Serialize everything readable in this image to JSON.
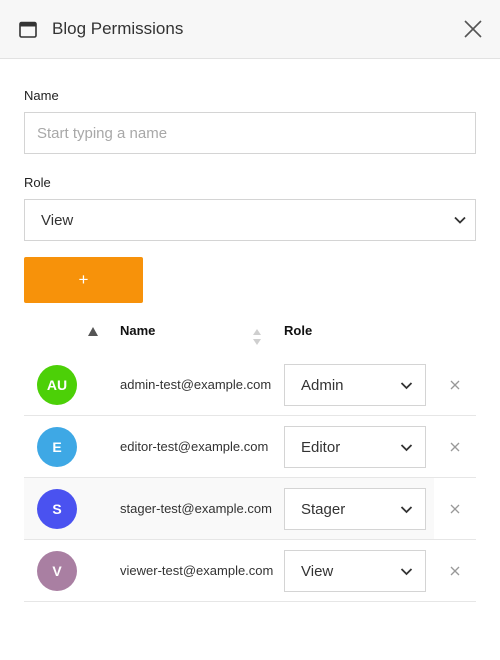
{
  "header": {
    "title": "Blog Permissions",
    "icon": "calendar-icon",
    "close_icon": "close-icon"
  },
  "form": {
    "name_label": "Name",
    "name_placeholder": "Start typing a name",
    "name_value": "",
    "role_label": "Role",
    "role_value": "View",
    "add_button_label": "+",
    "add_button_color": "#f7920a"
  },
  "table": {
    "columns": [
      "Name",
      "Role"
    ],
    "sort_column": "Name",
    "rows": [
      {
        "initials": "AU",
        "color": "#4cd007",
        "email": "admin-test@example.com",
        "role": "Admin"
      },
      {
        "initials": "E",
        "color": "#3ea8e5",
        "email": "editor-test@example.com",
        "role": "Editor"
      },
      {
        "initials": "S",
        "color": "#4a52f0",
        "email": "stager-test@example.com",
        "role": "Stager"
      },
      {
        "initials": "V",
        "color": "#a97fa2",
        "email": "viewer-test@example.com",
        "role": "View"
      }
    ]
  }
}
